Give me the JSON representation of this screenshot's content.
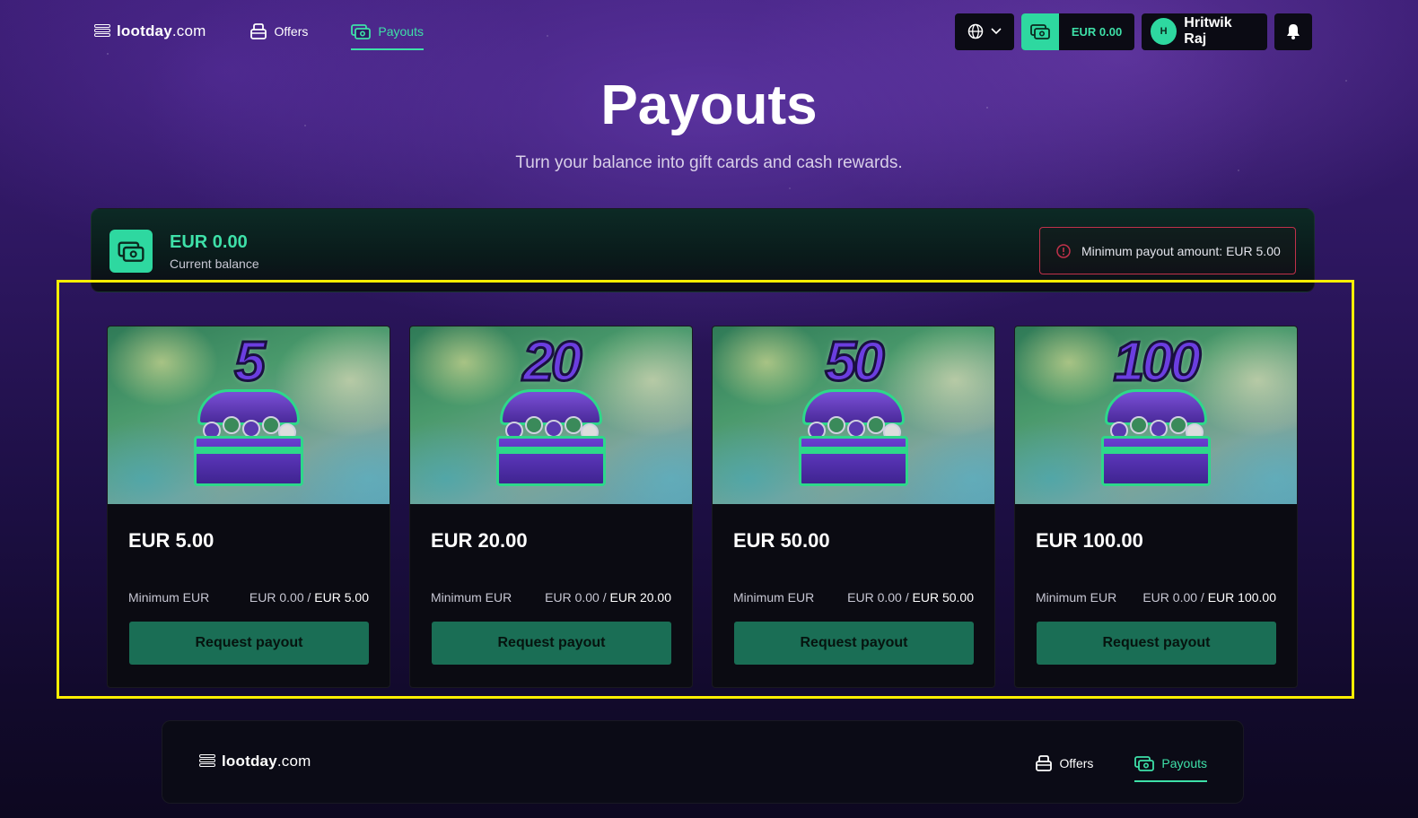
{
  "brand": {
    "name": "lootday",
    "tld": ".com"
  },
  "nav": {
    "items": [
      {
        "label": "Offers",
        "icon": "bag-icon",
        "active": false
      },
      {
        "label": "Payouts",
        "icon": "cash-icon",
        "active": true
      }
    ]
  },
  "header": {
    "balance": "EUR 0.00",
    "user": {
      "initial": "H",
      "name": "Hritwik Raj"
    }
  },
  "hero": {
    "title": "Payouts",
    "subtitle": "Turn your balance into gift cards and cash rewards."
  },
  "balance_panel": {
    "amount": "EUR 0.00",
    "label": "Current balance",
    "notice": "Minimum payout amount: EUR 5.00"
  },
  "payout_cards": [
    {
      "numeral": "5",
      "title": "EUR 5.00",
      "min_label": "Minimum EUR",
      "current": "EUR 0.00",
      "separator": " / ",
      "required": "EUR 5.00",
      "button": "Request payout"
    },
    {
      "numeral": "20",
      "title": "EUR 20.00",
      "min_label": "Minimum EUR",
      "current": "EUR 0.00",
      "separator": " / ",
      "required": "EUR 20.00",
      "button": "Request payout"
    },
    {
      "numeral": "50",
      "title": "EUR 50.00",
      "min_label": "Minimum EUR",
      "current": "EUR 0.00",
      "separator": " / ",
      "required": "EUR 50.00",
      "button": "Request payout"
    },
    {
      "numeral": "100",
      "title": "EUR 100.00",
      "min_label": "Minimum EUR",
      "current": "EUR 0.00",
      "separator": " / ",
      "required": "EUR 100.00",
      "button": "Request payout"
    }
  ],
  "footer": {
    "nav": [
      {
        "label": "Offers",
        "icon": "bag-icon"
      },
      {
        "label": "Payouts",
        "icon": "cash-icon",
        "active": true
      }
    ]
  },
  "colors": {
    "accent": "#2ed8a0",
    "button": "#1a6e55",
    "alert_border": "#c0314a",
    "highlight": "#ffee00"
  }
}
